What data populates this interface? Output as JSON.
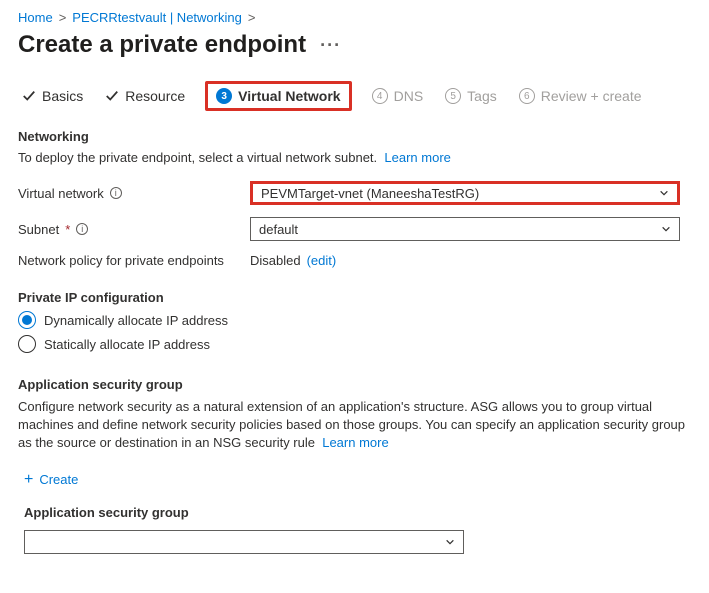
{
  "breadcrumb": {
    "home": "Home",
    "vault": "PECRRtestvault | Networking"
  },
  "pageTitle": "Create a private endpoint",
  "tabs": {
    "basics": "Basics",
    "resource": "Resource",
    "vnet": {
      "num": "3",
      "label": "Virtual Network"
    },
    "dns": {
      "num": "4",
      "label": "DNS"
    },
    "tags": {
      "num": "5",
      "label": "Tags"
    },
    "review": {
      "num": "6",
      "label": "Review + create"
    }
  },
  "networking": {
    "title": "Networking",
    "desc": "To deploy the private endpoint, select a virtual network subnet.",
    "learnMore": "Learn more",
    "vnetLabel": "Virtual network",
    "vnetValue": "PEVMTarget-vnet (ManeeshaTestRG)",
    "subnetLabel": "Subnet",
    "subnetValue": "default",
    "policyLabel": "Network policy for private endpoints",
    "policyValue": "Disabled",
    "editLabel": "(edit)"
  },
  "ipConfig": {
    "title": "Private IP configuration",
    "dynamic": "Dynamically allocate IP address",
    "static": "Statically allocate IP address"
  },
  "asg": {
    "title": "Application security group",
    "desc": "Configure network security as a natural extension of an application's structure. ASG allows you to group virtual machines and define network security policies based on those groups. You can specify an application security group as the source or destination in an NSG security rule",
    "learnMore": "Learn more",
    "create": "Create",
    "label": "Application security group"
  }
}
